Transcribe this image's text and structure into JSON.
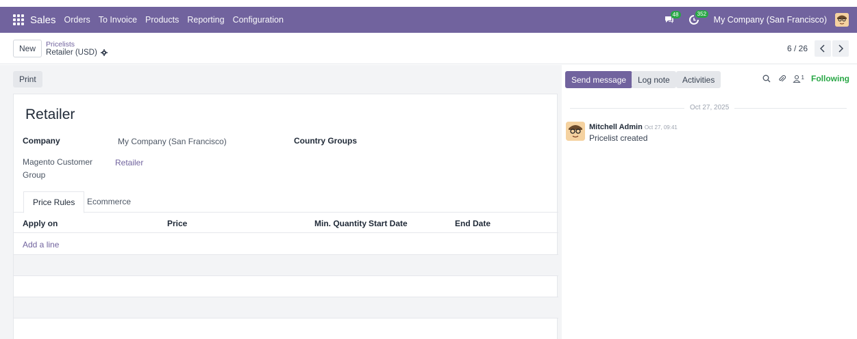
{
  "navbar": {
    "brand": "Sales",
    "menu": [
      "Orders",
      "To Invoice",
      "Products",
      "Reporting",
      "Configuration"
    ],
    "messages_count": "48",
    "activities_count": "352",
    "company": "My Company (San Francisco)",
    "icons": [
      "apps-grid-icon",
      "chat-icon",
      "clock-icon",
      "user-avatar"
    ]
  },
  "control": {
    "new_label": "New",
    "breadcrumb_parent": "Pricelists",
    "breadcrumb_current": "Retailer (USD)",
    "pager": "6 / 26"
  },
  "form": {
    "print_label": "Print",
    "title": "Retailer",
    "company_label": "Company",
    "company_value": "My Company (San Francisco)",
    "country_groups_label": "Country Groups",
    "magento_label": "Magento Customer Group",
    "magento_value": "Retailer",
    "tabs": [
      "Price Rules",
      "Ecommerce"
    ],
    "columns": [
      "Apply on",
      "Price",
      "Min. Quantity",
      "Start Date",
      "End Date"
    ],
    "add_line": "Add a line"
  },
  "chatter": {
    "send_message": "Send message",
    "log_note": "Log note",
    "activities": "Activities",
    "followers_count": "1",
    "following": "Following",
    "date": "Oct 27, 2025",
    "message": {
      "author": "Mitchell Admin",
      "time": "Oct 27, 09:41",
      "body": "Pricelist created"
    }
  },
  "colors": {
    "brand": "#71639e",
    "success": "#28a745"
  }
}
